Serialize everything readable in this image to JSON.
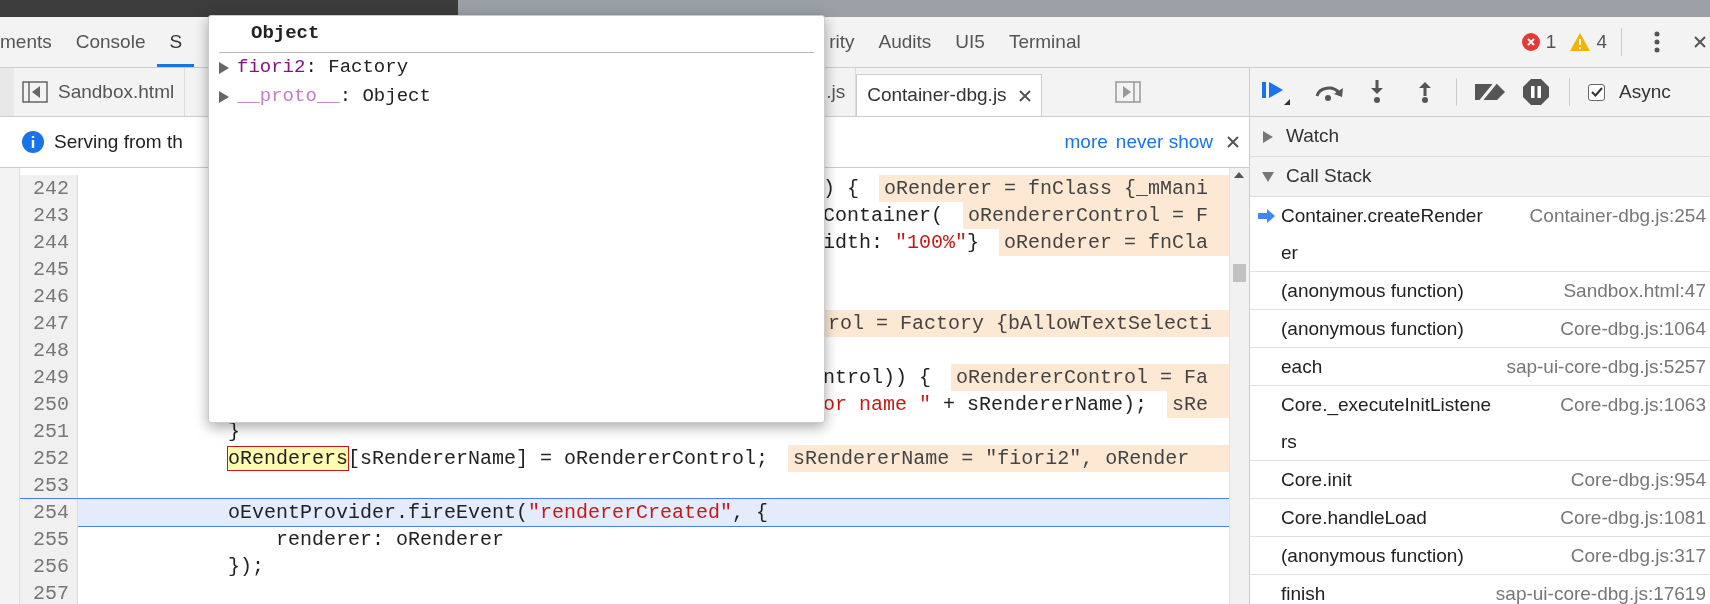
{
  "tabs": [
    {
      "label": "ments",
      "selected": false
    },
    {
      "label": "Console",
      "selected": false
    },
    {
      "label": "S",
      "selected": true
    },
    {
      "label": "rity",
      "selected": false
    },
    {
      "label": "Audits",
      "selected": false
    },
    {
      "label": "UI5",
      "selected": false
    },
    {
      "label": "Terminal",
      "selected": false
    }
  ],
  "counters": {
    "errors": "1",
    "warnings": "4"
  },
  "file_tabs": [
    {
      "label": "Sandbox.html",
      "selected": false
    },
    {
      "label": ".js",
      "selected": false
    },
    {
      "label": "Container-dbg.js",
      "selected": true
    }
  ],
  "infobar": {
    "message": "Serving from th",
    "links": [
      "more",
      "never show"
    ]
  },
  "code_lines": [
    {
      "number": "242",
      "kind": "covered",
      "selected": false,
      "segments": [
        {
          "kind": "plain",
          "text": ") {"
        }
      ],
      "annotation": "oRenderer = fnClass {_mMani"
    },
    {
      "number": "243",
      "kind": "covered",
      "selected": false,
      "segments": [
        {
          "kind": "plain",
          "text": "Container("
        }
      ],
      "annotation": "oRendererControl = F"
    },
    {
      "number": "244",
      "kind": "covered",
      "selected": false,
      "segments": [
        {
          "kind": "plain",
          "text": "idth: "
        },
        {
          "kind": "string",
          "text": "\"100%\""
        },
        {
          "kind": "plain",
          "text": "}"
        }
      ],
      "annotation": "oRenderer = fnCla"
    },
    {
      "number": "245",
      "kind": "covered",
      "selected": false
    },
    {
      "number": "246",
      "kind": "covered",
      "selected": false
    },
    {
      "number": "247",
      "kind": "covered",
      "selected": false,
      "annotation": "rol = Factory {bAllowTextSelecti"
    },
    {
      "number": "248",
      "kind": "covered",
      "selected": false
    },
    {
      "number": "249",
      "kind": "covered",
      "selected": false,
      "segments": [
        {
          "kind": "plain",
          "text": "ntrol)) {"
        }
      ],
      "annotation": "oRendererControl = Fa"
    },
    {
      "number": "250",
      "kind": "covered",
      "selected": false,
      "segments": [
        {
          "kind": "string",
          "text": "or name \""
        },
        {
          "kind": "plain",
          "text": " + sRendererName);"
        }
      ],
      "annotation": "sRe"
    },
    {
      "number": "251",
      "kind": "indented",
      "selected": false,
      "segments": [
        {
          "kind": "plain",
          "text": "}"
        }
      ]
    },
    {
      "number": "252",
      "kind": "indented",
      "selected": false,
      "segments": [
        {
          "kind": "highlight",
          "text": "oRenderers"
        },
        {
          "kind": "plain",
          "text": "[sRendererName] = oRendererControl;"
        }
      ],
      "annotation": "sRendererName = \"fiori2\", oRender"
    },
    {
      "number": "253",
      "kind": "indented",
      "selected": false
    },
    {
      "number": "254",
      "kind": "indented",
      "selected": true,
      "segments": [
        {
          "kind": "plain",
          "text": "oEventProvider.fireEvent("
        },
        {
          "kind": "string",
          "text": "\"rendererCreated\""
        },
        {
          "kind": "plain",
          "text": ", {"
        }
      ]
    },
    {
      "number": "255",
      "kind": "nested",
      "selected": false,
      "segments": [
        {
          "kind": "plain",
          "text": "renderer: oRenderer"
        }
      ]
    },
    {
      "number": "256",
      "kind": "indented",
      "selected": false,
      "segments": [
        {
          "kind": "plain",
          "text": "});"
        }
      ]
    },
    {
      "number": "257",
      "kind": "indented",
      "selected": false
    }
  ],
  "popover": {
    "title": "Object",
    "properties": [
      {
        "name": "fiori2",
        "value": ": Factory",
        "kind": "own"
      },
      {
        "name": "__proto__",
        "value": ": Object",
        "kind": "inherited"
      }
    ]
  },
  "debugger": {
    "async": {
      "label": "Async",
      "checked": true
    },
    "sections": [
      {
        "title": "Watch",
        "expanded": false
      },
      {
        "title": "Call Stack",
        "expanded": true,
        "frames": [
          {
            "function": "Container.createRenderer",
            "location": "Container-dbg.js:254",
            "selected": true
          },
          {
            "function": "(anonymous function)",
            "location": "Sandbox.html:47",
            "selected": false
          },
          {
            "function": "(anonymous function)",
            "location": "Core-dbg.js:1064",
            "selected": false
          },
          {
            "function": "each",
            "location": "sap-ui-core-dbg.js:5257",
            "selected": false
          },
          {
            "function": "Core._executeInitListeners",
            "location": "Core-dbg.js:1063",
            "selected": false
          },
          {
            "function": "Core.init",
            "location": "Core-dbg.js:954",
            "selected": false
          },
          {
            "function": "Core.handleLoad",
            "location": "Core-dbg.js:1081",
            "selected": false
          },
          {
            "function": "(anonymous function)",
            "location": "Core-dbg.js:317",
            "selected": false
          },
          {
            "function": "finish",
            "location": "sap-ui-core-dbg.js:17619",
            "selected": false
          }
        ]
      }
    ]
  }
}
